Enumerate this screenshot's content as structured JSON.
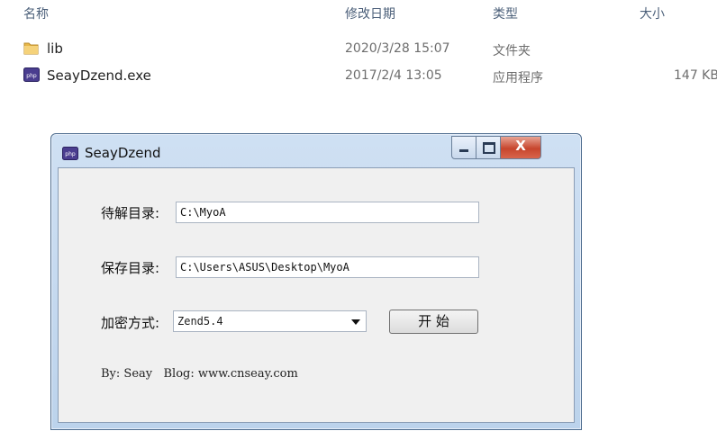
{
  "explorer": {
    "columns": {
      "name": "名称",
      "modified": "修改日期",
      "type": "类型",
      "size": "大小"
    },
    "files": [
      {
        "name": "lib",
        "modified": "2020/3/28 15:07",
        "type": "文件夹",
        "size": "",
        "icon": "folder-icon"
      },
      {
        "name": "SeayDzend.exe",
        "modified": "2017/2/4 13:05",
        "type": "应用程序",
        "size": "147 KB",
        "icon": "exe-icon"
      }
    ]
  },
  "dialog": {
    "title": "SeayDzend",
    "close_label": "X",
    "decrypt_dir_label": "待解目录:",
    "decrypt_dir_value": "C:\\MyoA",
    "save_dir_label": "保存目录:",
    "save_dir_value": "C:\\Users\\ASUS\\Desktop\\MyoA",
    "encrypt_label": "加密方式:",
    "encrypt_value": "Zend5.4",
    "start_label": "开 始",
    "footer": "By: Seay   Blog: www.cnseay.com"
  }
}
